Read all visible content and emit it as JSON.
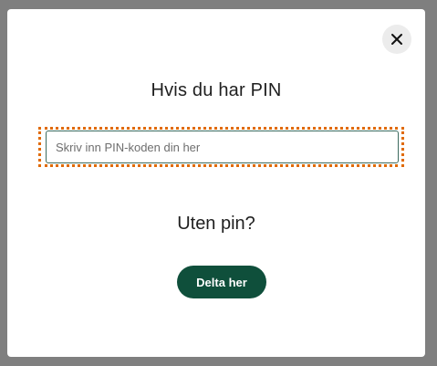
{
  "dialog": {
    "close_icon": "close-icon",
    "pin_heading": "Hvis du har PIN",
    "pin_input": {
      "value": "",
      "placeholder": "Skriv inn PIN-koden din her"
    },
    "no_pin_heading": "Uten pin?",
    "join_button_label": "Delta her"
  },
  "colors": {
    "backdrop": "#7f7f7f",
    "primary_button": "#0f4f3b",
    "focus_outline": "#e06a00",
    "input_border": "#3d6b5f"
  }
}
